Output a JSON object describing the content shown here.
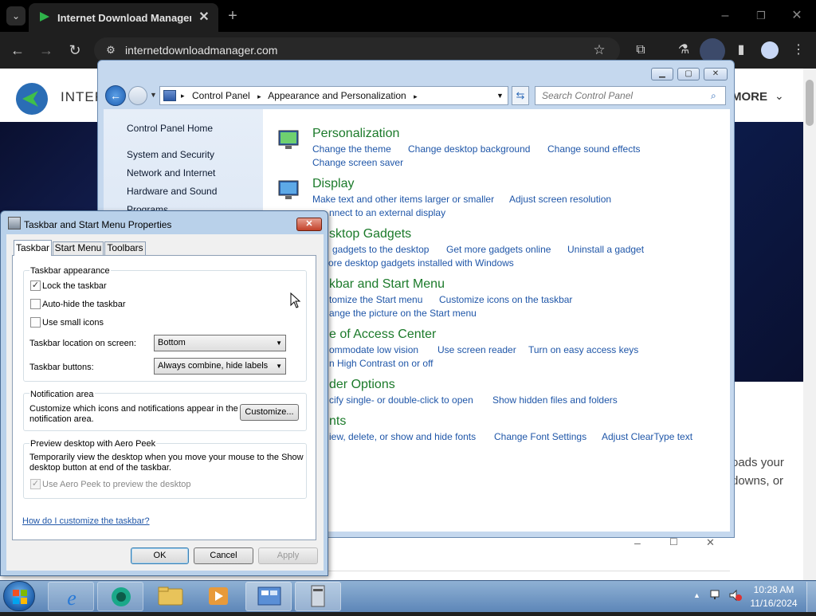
{
  "browser": {
    "tab_title": "Internet Download Manager is",
    "address": "internetdownloadmanager.com"
  },
  "website": {
    "logo_text": "INTER",
    "more_label": "MORE",
    "partial_text_1": "oads your",
    "partial_text_2": "downs, or"
  },
  "control_panel": {
    "breadcrumb": [
      "Control Panel",
      "Appearance and Personalization"
    ],
    "search_placeholder": "Search Control Panel",
    "sidebar": {
      "home": "Control Panel Home",
      "items": [
        "System and Security",
        "Network and Internet",
        "Hardware and Sound",
        "Programs"
      ]
    },
    "categories": [
      {
        "title": "Personalization",
        "links": [
          "Change the theme",
          "Change desktop background",
          "Change sound effects",
          "Change screen saver"
        ]
      },
      {
        "title": "Display",
        "links": [
          "Make text and other items larger or smaller",
          "Adjust screen resolution",
          "nnect to an external display"
        ]
      },
      {
        "title": "sktop Gadgets",
        "links": [
          "gadgets to the desktop",
          "Get more gadgets online",
          "Uninstall a gadget",
          "ore desktop gadgets installed with Windows"
        ]
      },
      {
        "title": "kbar and Start Menu",
        "links": [
          "tomize the Start menu",
          "Customize icons on the taskbar",
          "ange the picture on the Start menu"
        ]
      },
      {
        "title": "e of Access Center",
        "links": [
          "ommodate low vision",
          "Use screen reader",
          "Turn on easy access keys",
          "n High Contrast on or off"
        ]
      },
      {
        "title": "der Options",
        "links": [
          "cify single- or double-click to open",
          "Show hidden files and folders"
        ]
      },
      {
        "title": "nts",
        "links": [
          "iew, delete, or show and hide fonts",
          "Change Font Settings",
          "Adjust ClearType text"
        ]
      }
    ]
  },
  "dialog": {
    "title": "Taskbar and Start Menu Properties",
    "tabs": [
      "Taskbar",
      "Start Menu",
      "Toolbars"
    ],
    "appearance": {
      "heading": "Taskbar appearance",
      "lock_label": "Lock the taskbar",
      "lock_checked": "✓",
      "autohide_label": "Auto-hide the taskbar",
      "small_icons_label": "Use small icons",
      "location_label": "Taskbar location on screen:",
      "location_value": "Bottom",
      "buttons_label": "Taskbar buttons:",
      "buttons_value": "Always combine, hide labels"
    },
    "notification": {
      "heading": "Notification area",
      "text": "Customize which icons and notifications appear in the notification area.",
      "button": "Customize..."
    },
    "peek": {
      "heading": "Preview desktop with Aero Peek",
      "text": "Temporarily view the desktop when you move your mouse to the Show desktop button at end of the taskbar.",
      "checkbox_label": "Use Aero Peek to preview the desktop",
      "checked": "✓"
    },
    "help_link": "How do I customize the taskbar?",
    "buttons": {
      "ok": "OK",
      "cancel": "Cancel",
      "apply": "Apply"
    }
  },
  "taskbar": {
    "time": "10:28 AM",
    "date": "11/16/2024"
  }
}
